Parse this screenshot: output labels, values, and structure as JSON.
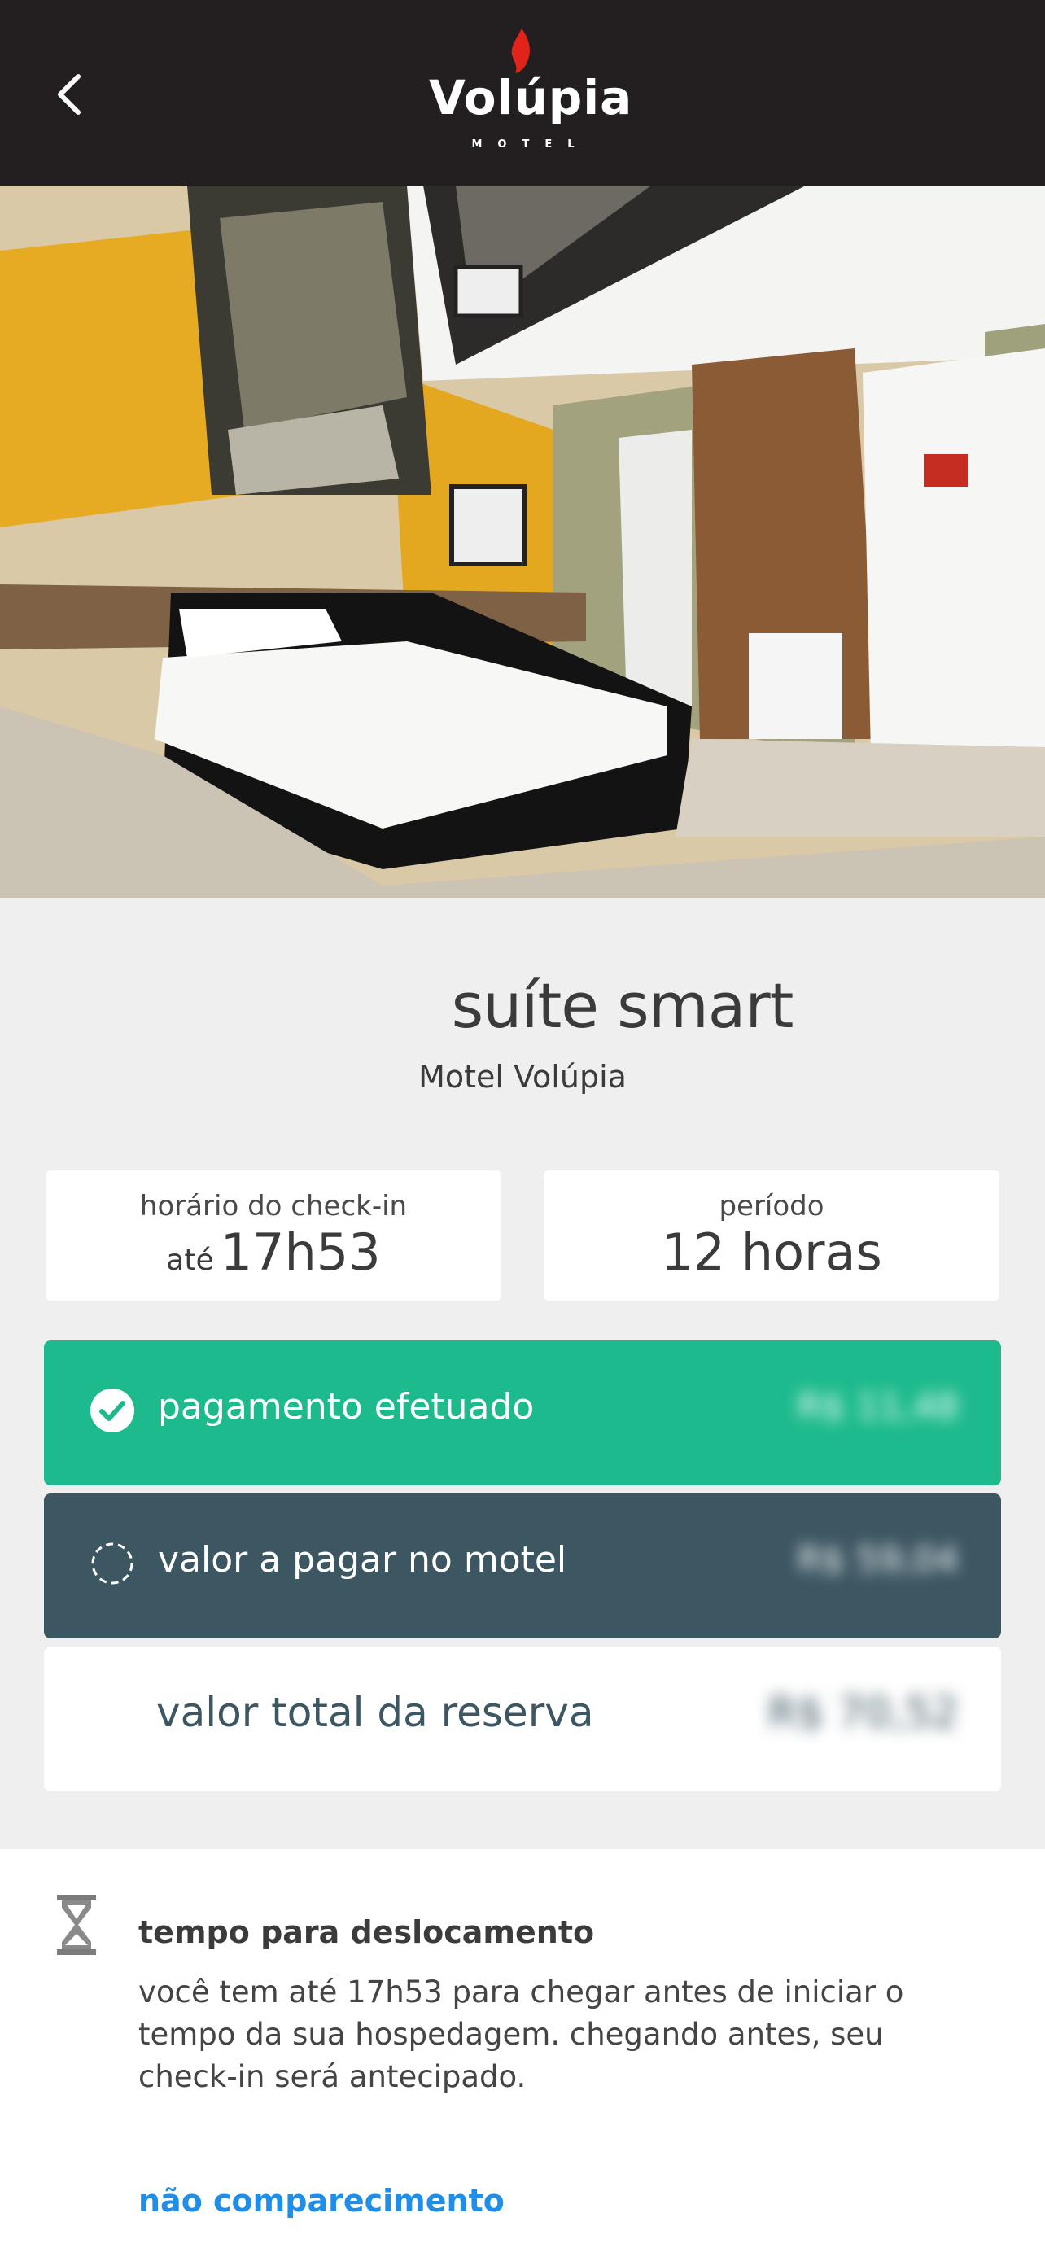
{
  "header": {
    "logo_text": "Volúpia",
    "logo_subtext": "MOTEL",
    "back_icon": "chevron-left-icon"
  },
  "room": {
    "name": "suíte smart",
    "motel": "Motel Volúpia"
  },
  "checkin": {
    "label": "horário do check-in",
    "prefix": "até",
    "time": "17h53"
  },
  "period": {
    "label": "período",
    "value": "12 horas"
  },
  "payments": {
    "paid_label": "pagamento efetuado",
    "paid_amount": "R$ 11,48",
    "due_label": "valor a pagar no motel",
    "due_amount": "R$ 59,04",
    "total_label": "valor total da reserva",
    "total_amount": "R$ 70,52"
  },
  "travel": {
    "title": "tempo para deslocamento",
    "text": "você tem até 17h53 para chegar antes de iniciar o tempo da sua hospedagem. chegando antes, seu check-in será antecipado.",
    "link": "não comparecimento"
  },
  "colors": {
    "header_bg": "#231f20",
    "paid_bg": "#1dba8d",
    "due_bg": "#3c5662",
    "link": "#1f8ee8",
    "flame": "#e2231a"
  }
}
